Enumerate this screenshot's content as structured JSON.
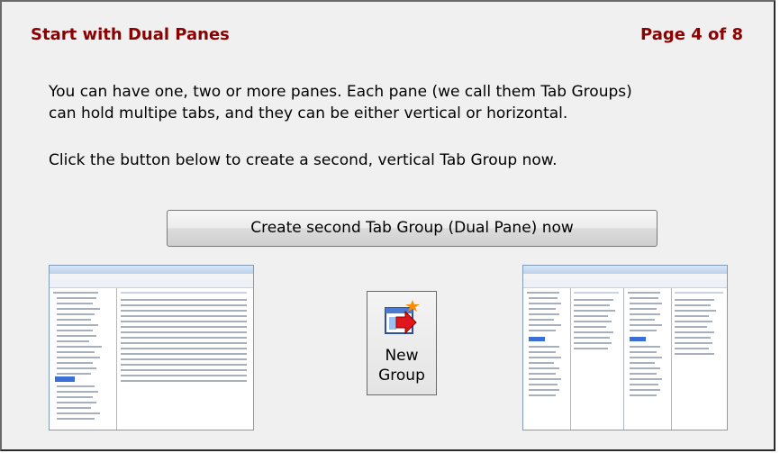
{
  "header": {
    "title": "Start with Dual Panes",
    "page_indicator": "Page 4 of 8"
  },
  "body": {
    "paragraph1_line1": "You can have one, two or more panes. Each pane (we call them Tab Groups)",
    "paragraph1_line2": "can hold multipe tabs, and they can be either vertical or horizontal.",
    "paragraph2": "Click the button below to create a second, vertical Tab Group now."
  },
  "actions": {
    "create_button_label": "Create second Tab Group (Dual Pane) now",
    "new_group_label_line1": "New",
    "new_group_label_line2": "Group"
  },
  "colors": {
    "title": "#8b0000",
    "panel_bg": "#f0f0f0"
  },
  "icons": {
    "new_group": "new-group-icon",
    "single_pane_preview": "single-pane-screenshot",
    "dual_pane_preview": "dual-pane-screenshot"
  }
}
